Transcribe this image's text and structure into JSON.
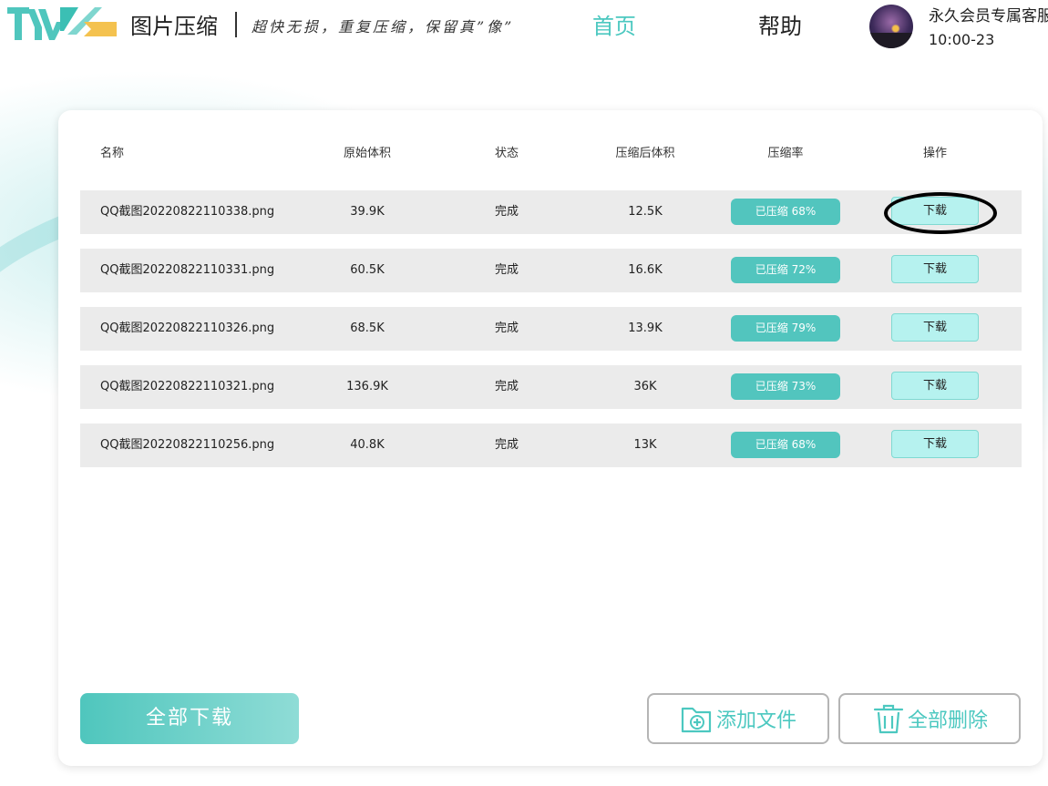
{
  "header": {
    "logo_text": "TIYG",
    "app_title": "图片压缩",
    "slogan": "超快无损，重复压缩，保留真”像”",
    "nav": {
      "home": "首页",
      "help": "帮助"
    },
    "user": {
      "name": "永久会员专属客服",
      "time": "10:00-23"
    }
  },
  "table": {
    "columns": [
      "名称",
      "原始体积",
      "状态",
      "压缩后体积",
      "压缩率",
      "操作"
    ],
    "rows": [
      {
        "name": "QQ截图20220822110338.png",
        "original": "39.9K",
        "status": "完成",
        "compressed": "12.5K",
        "rate": "已压缩 68%",
        "action": "下载"
      },
      {
        "name": "QQ截图20220822110331.png",
        "original": "60.5K",
        "status": "完成",
        "compressed": "16.6K",
        "rate": "已压缩 72%",
        "action": "下载"
      },
      {
        "name": "QQ截图20220822110326.png",
        "original": "68.5K",
        "status": "完成",
        "compressed": "13.9K",
        "rate": "已压缩 79%",
        "action": "下载"
      },
      {
        "name": "QQ截图20220822110321.png",
        "original": "136.9K",
        "status": "完成",
        "compressed": "36K",
        "rate": "已压缩 73%",
        "action": "下载"
      },
      {
        "name": "QQ截图20220822110256.png",
        "original": "40.8K",
        "status": "完成",
        "compressed": "13K",
        "rate": "已压缩 68%",
        "action": "下载"
      }
    ]
  },
  "actions": {
    "download_all": "全部下载",
    "add_file": "添加文件",
    "delete_all": "全部删除"
  },
  "icons": {
    "logo": "logo-icon",
    "add": "folder-plus-icon",
    "delete": "trash-icon"
  },
  "colors": {
    "accent": "#4cc8c0",
    "badge": "#52c5be",
    "download_button": "#b6f2ef",
    "row_background": "#ebebeb"
  }
}
